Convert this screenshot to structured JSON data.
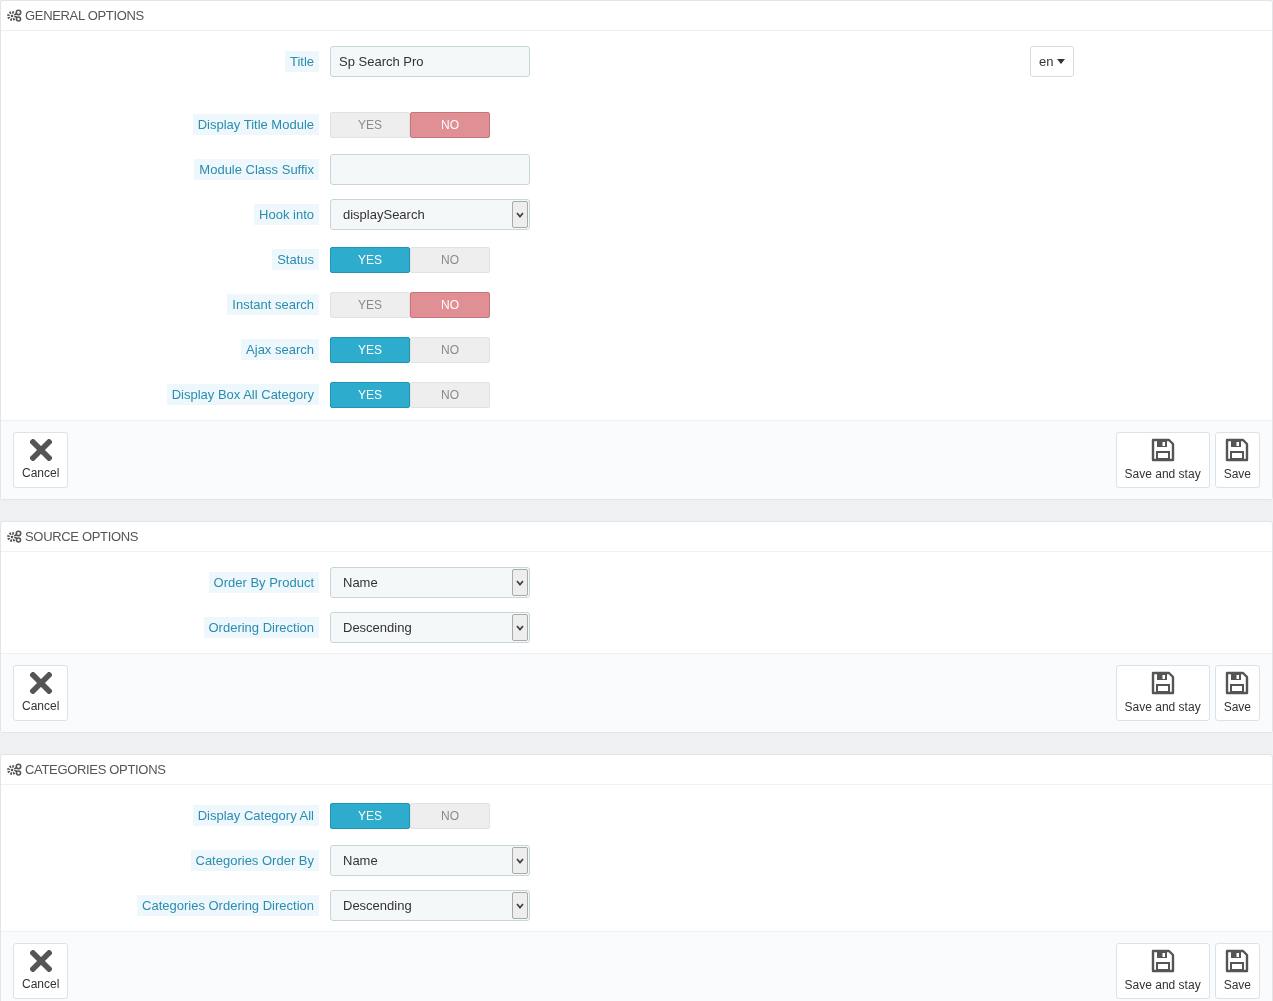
{
  "panels": [
    {
      "title": "GENERAL OPTIONS",
      "fields": [
        {
          "kind": "text",
          "label": "Title",
          "value": "Sp Search Pro",
          "language": "en"
        },
        {
          "kind": "toggle",
          "label": "Display Title Module",
          "options": [
            {
              "label": "YES",
              "selected": false
            },
            {
              "label": "NO",
              "selected": true
            }
          ]
        },
        {
          "kind": "text",
          "label": "Module Class Suffix"
        },
        {
          "kind": "select",
          "label": "Hook into",
          "value": "displaySearch"
        },
        {
          "kind": "toggle",
          "label": "Status",
          "options": [
            {
              "label": "YES",
              "selected": true
            },
            {
              "label": "NO",
              "selected": false
            }
          ]
        },
        {
          "kind": "toggle",
          "label": "Instant search",
          "options": [
            {
              "label": "YES",
              "selected": false
            },
            {
              "label": "NO",
              "selected": true
            }
          ]
        },
        {
          "kind": "toggle",
          "label": "Ajax search",
          "options": [
            {
              "label": "YES",
              "selected": true
            },
            {
              "label": "NO",
              "selected": false
            }
          ]
        },
        {
          "kind": "toggle",
          "label": "Display Box All Category",
          "options": [
            {
              "label": "YES",
              "selected": true
            },
            {
              "label": "NO",
              "selected": false
            }
          ]
        }
      ],
      "footer": {
        "cancel": "Cancel",
        "save_and_stay": "Save and stay",
        "save": "Save"
      }
    },
    {
      "title": "SOURCE OPTIONS",
      "fields": [
        {
          "kind": "select",
          "label": "Order By Product",
          "value": "Name"
        },
        {
          "kind": "select",
          "label": "Ordering Direction",
          "value": "Descending"
        }
      ],
      "footer": {
        "cancel": "Cancel",
        "save_and_stay": "Save and stay",
        "save": "Save"
      }
    },
    {
      "title": "CATEGORIES OPTIONS",
      "fields": [
        {
          "kind": "toggle",
          "label": "Display Category All",
          "options": [
            {
              "label": "YES",
              "selected": true
            },
            {
              "label": "NO",
              "selected": false
            }
          ]
        },
        {
          "kind": "select",
          "label": "Categories Order By",
          "value": "Name"
        },
        {
          "kind": "select",
          "label": "Categories Ordering Direction",
          "value": "Descending"
        }
      ],
      "footer": {
        "cancel": "Cancel",
        "save_and_stay": "Save and stay",
        "save": "Save"
      }
    }
  ]
}
